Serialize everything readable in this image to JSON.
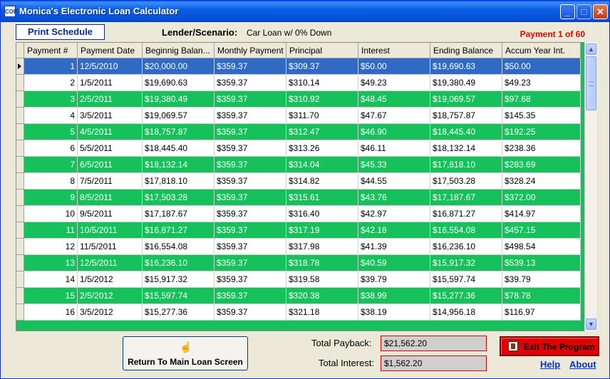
{
  "window": {
    "title": "Monica's Electronic Loan Calculator",
    "icon_text": "COP"
  },
  "toolbar": {
    "print_label": "Print Schedule",
    "lender_label": "Lender/Scenario:",
    "lender_value": "Car Loan w/ 0% Down",
    "payment_counter": "Payment 1 of 60"
  },
  "grid": {
    "columns": [
      "Payment #",
      "Payment Date",
      "Beginnig Balan...",
      "Monthly Payment",
      "Principal",
      "Interest",
      "Ending Balance",
      "Accum Year Int."
    ],
    "rows": [
      [
        "1",
        "12/5/2010",
        "$20,000.00",
        "$359.37",
        "$309.37",
        "$50.00",
        "$19,690.63",
        "$50.00"
      ],
      [
        "2",
        "1/5/2011",
        "$19,690.63",
        "$359.37",
        "$310.14",
        "$49.23",
        "$19,380.49",
        "$49.23"
      ],
      [
        "3",
        "2/5/2011",
        "$19,380.49",
        "$359.37",
        "$310.92",
        "$48.45",
        "$19,069.57",
        "$97.68"
      ],
      [
        "4",
        "3/5/2011",
        "$19,069.57",
        "$359.37",
        "$311.70",
        "$47.67",
        "$18,757.87",
        "$145.35"
      ],
      [
        "5",
        "4/5/2011",
        "$18,757.87",
        "$359.37",
        "$312.47",
        "$46.90",
        "$18,445.40",
        "$192.25"
      ],
      [
        "6",
        "5/5/2011",
        "$18,445.40",
        "$359.37",
        "$313.26",
        "$46.11",
        "$18,132.14",
        "$238.36"
      ],
      [
        "7",
        "6/5/2011",
        "$18,132.14",
        "$359.37",
        "$314.04",
        "$45.33",
        "$17,818.10",
        "$283.69"
      ],
      [
        "8",
        "7/5/2011",
        "$17,818.10",
        "$359.37",
        "$314.82",
        "$44.55",
        "$17,503.28",
        "$328.24"
      ],
      [
        "9",
        "8/5/2011",
        "$17,503.28",
        "$359.37",
        "$315.61",
        "$43.76",
        "$17,187.67",
        "$372.00"
      ],
      [
        "10",
        "9/5/2011",
        "$17,187.67",
        "$359.37",
        "$316.40",
        "$42.97",
        "$16,871.27",
        "$414.97"
      ],
      [
        "11",
        "10/5/2011",
        "$16,871.27",
        "$359.37",
        "$317.19",
        "$42.18",
        "$16,554.08",
        "$457.15"
      ],
      [
        "12",
        "11/5/2011",
        "$16,554.08",
        "$359.37",
        "$317.98",
        "$41.39",
        "$16,236.10",
        "$498.54"
      ],
      [
        "13",
        "12/5/2011",
        "$16,236.10",
        "$359.37",
        "$318.78",
        "$40.59",
        "$15,917.32",
        "$539.13"
      ],
      [
        "14",
        "1/5/2012",
        "$15,917.32",
        "$359.37",
        "$319.58",
        "$39.79",
        "$15,597.74",
        "$39.79"
      ],
      [
        "15",
        "2/5/2012",
        "$15,597.74",
        "$359.37",
        "$320.38",
        "$38.99",
        "$15,277.36",
        "$78.78"
      ],
      [
        "16",
        "3/5/2012",
        "$15,277.36",
        "$359.37",
        "$321.18",
        "$38.19",
        "$14,956.18",
        "$116.97"
      ]
    ]
  },
  "footer": {
    "return_label": "Return To Main Loan Screen",
    "total_payback_label": "Total Payback:",
    "total_payback_value": "$21,562.20",
    "total_interest_label": "Total Interest:",
    "total_interest_value": "$1,562.20",
    "exit_label": "Exit The Program",
    "help_label": "Help",
    "about_label": "About"
  },
  "colors": {
    "titlebar": "#0750d8",
    "row_green": "#16c05a",
    "row_selected": "#316ac5",
    "exit_red": "#e00000",
    "counter_red": "#e60000"
  },
  "icons": {
    "minimize": "minimize-icon",
    "maximize": "maximize-icon",
    "close": "close-icon",
    "return": "pointer-hand-icon",
    "exit": "door-exit-icon"
  }
}
